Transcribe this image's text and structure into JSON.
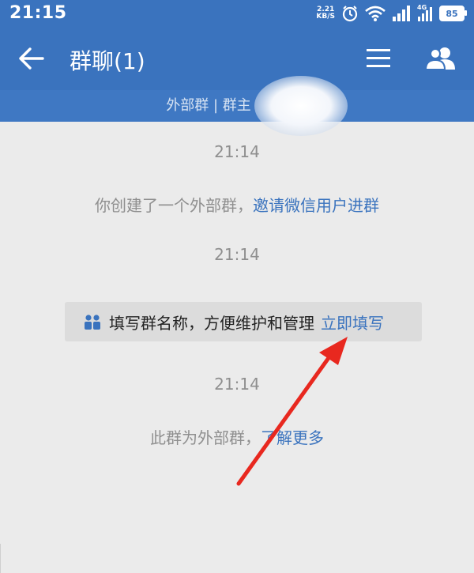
{
  "status": {
    "time": "21:15",
    "speed_value": "2.21",
    "speed_unit": "KB/S",
    "network": "4G",
    "battery": "85"
  },
  "header": {
    "title": "群聊(1)"
  },
  "subheader": {
    "text": "外部群 | 群主"
  },
  "chat": {
    "time1": "21:14",
    "sys1_text": "你创建了一个外部群，",
    "sys1_link": "邀请微信用户进群",
    "time2": "21:14",
    "notice_text": "填写群名称，方便维护和管理",
    "notice_link": "立即填写",
    "time3": "21:14",
    "sys2_text": "此群为外部群，",
    "sys2_link": "了解更多"
  },
  "colors": {
    "header_blue": "#3a73be",
    "link_blue": "#3a73be",
    "annotation_arrow": "#e8281f"
  },
  "icons": [
    "back-arrow-icon",
    "menu-icon",
    "group-members-icon",
    "alarm-icon",
    "wifi-icon",
    "signal-icon",
    "battery-icon",
    "people-icon"
  ]
}
